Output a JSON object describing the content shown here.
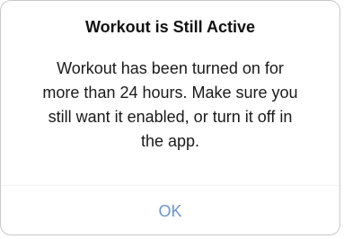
{
  "alert": {
    "title": "Workout is Still Active",
    "message_lines": [
      "Workout has been turned on for",
      "more than 24 hours. Make sure you",
      "still want it enabled, or turn it off in",
      "the app."
    ],
    "ok_label": "OK"
  },
  "colors": {
    "accent": "#6e96c6",
    "text": "#111111",
    "border": "#c8c8ca"
  }
}
